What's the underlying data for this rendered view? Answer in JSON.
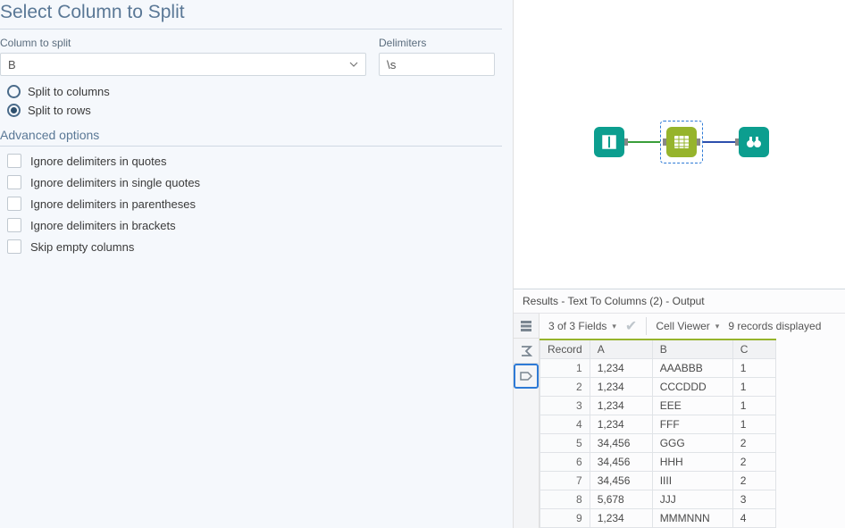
{
  "config": {
    "title": "Select Column to Split",
    "column_label": "Column to split",
    "column_value": "B",
    "delimiters_label": "Delimiters",
    "delimiters_value": "\\s",
    "radio_cols": "Split to columns",
    "radio_rows": "Split to rows",
    "adv_title": "Advanced options",
    "opts": {
      "quotes": "Ignore delimiters in quotes",
      "squotes": "Ignore delimiters in single quotes",
      "parens": "Ignore delimiters in parentheses",
      "brackets": "Ignore delimiters in brackets",
      "skip": "Skip empty columns"
    }
  },
  "results": {
    "title": "Results - Text To Columns (2) - Output",
    "fields_text": "3 of 3 Fields",
    "cell_viewer": "Cell Viewer",
    "records_text": "9 records displayed",
    "headers": {
      "rec": "Record",
      "a": "A",
      "b": "B",
      "c": "C"
    },
    "rows": [
      {
        "n": "1",
        "a": "1,234",
        "b": "AAABBB",
        "c": "1"
      },
      {
        "n": "2",
        "a": "1,234",
        "b": "CCCDDD",
        "c": "1"
      },
      {
        "n": "3",
        "a": "1,234",
        "b": "EEE",
        "c": "1"
      },
      {
        "n": "4",
        "a": "1,234",
        "b": "FFF",
        "c": "1"
      },
      {
        "n": "5",
        "a": "34,456",
        "b": "GGG",
        "c": "2"
      },
      {
        "n": "6",
        "a": "34,456",
        "b": "HHH",
        "c": "2"
      },
      {
        "n": "7",
        "a": "34,456",
        "b": "IIII",
        "c": "2"
      },
      {
        "n": "8",
        "a": "5,678",
        "b": "JJJ",
        "c": "3"
      },
      {
        "n": "9",
        "a": "1,234",
        "b": "MMMNNN",
        "c": "4"
      }
    ]
  }
}
